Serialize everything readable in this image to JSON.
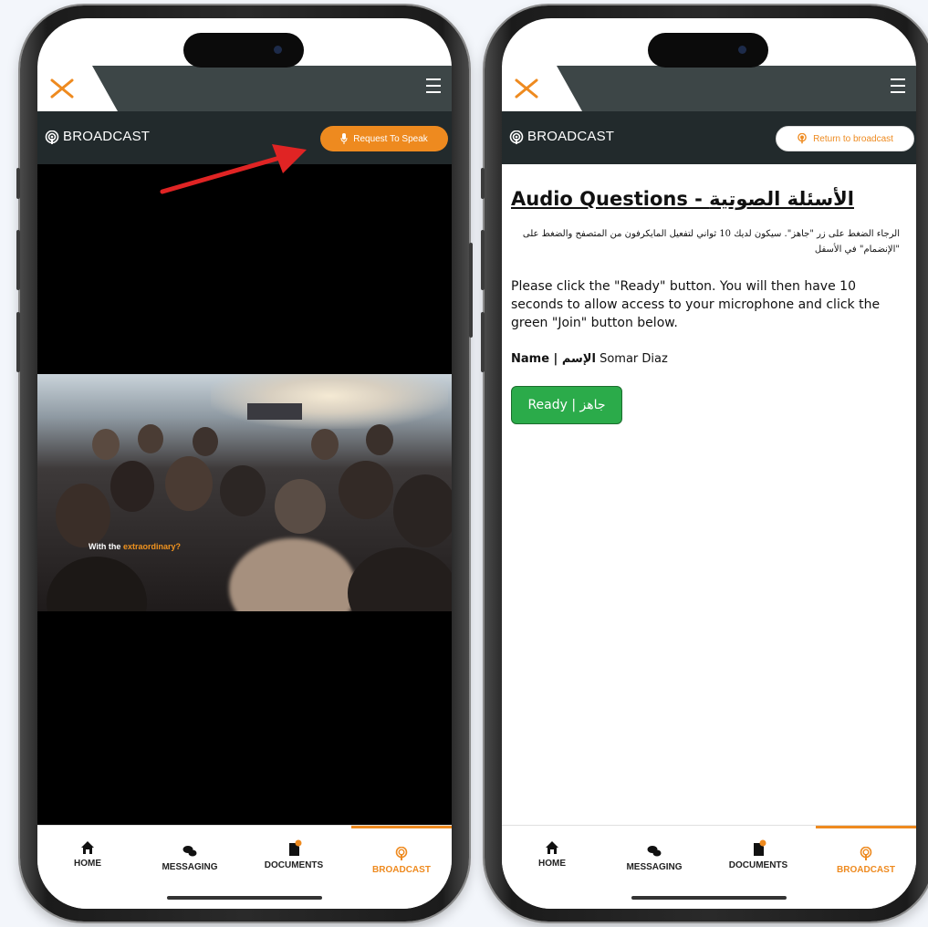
{
  "colors": {
    "accent": "#ee8a1f",
    "topbar_dark": "#3d4647",
    "subbar": "#222a2c",
    "ready_green": "#2bab4a",
    "arrow_red": "#e02424"
  },
  "left_phone": {
    "header": {
      "section_title": "BROADCAST",
      "action_button": "Request To Speak"
    },
    "video": {
      "caption_prefix": "With the",
      "caption_highlight": "extraordinary?"
    },
    "nav": [
      {
        "label": "HOME",
        "icon": "home-icon"
      },
      {
        "label": "MESSAGING",
        "icon": "chat-icon"
      },
      {
        "label": "DOCUMENTS",
        "icon": "document-icon"
      },
      {
        "label": "BROADCAST",
        "icon": "broadcast-icon"
      }
    ]
  },
  "right_phone": {
    "header": {
      "section_title": "BROADCAST",
      "action_button": "Return to broadcast"
    },
    "form": {
      "title": "Audio Questions - الأسئلة الصوتية",
      "arabic_instructions": "الرجاء الضغط على زر \"جاهز\". سيكون لديك 10 ثواني لتفعيل المايكرفون من المتصفح والضغط على \"الإنضمام\" في الأسفل",
      "english_instructions": "Please click the \"Ready\" button. You will then have 10 seconds to allow access to your microphone and click the green \"Join\" button below.",
      "name_label": "Name | الإسم",
      "name_value": "Somar Diaz",
      "ready_button": "Ready | جاهز"
    },
    "nav": [
      {
        "label": "HOME",
        "icon": "home-icon"
      },
      {
        "label": "MESSAGING",
        "icon": "chat-icon"
      },
      {
        "label": "DOCUMENTS",
        "icon": "document-icon"
      },
      {
        "label": "BROADCAST",
        "icon": "broadcast-icon"
      }
    ]
  }
}
